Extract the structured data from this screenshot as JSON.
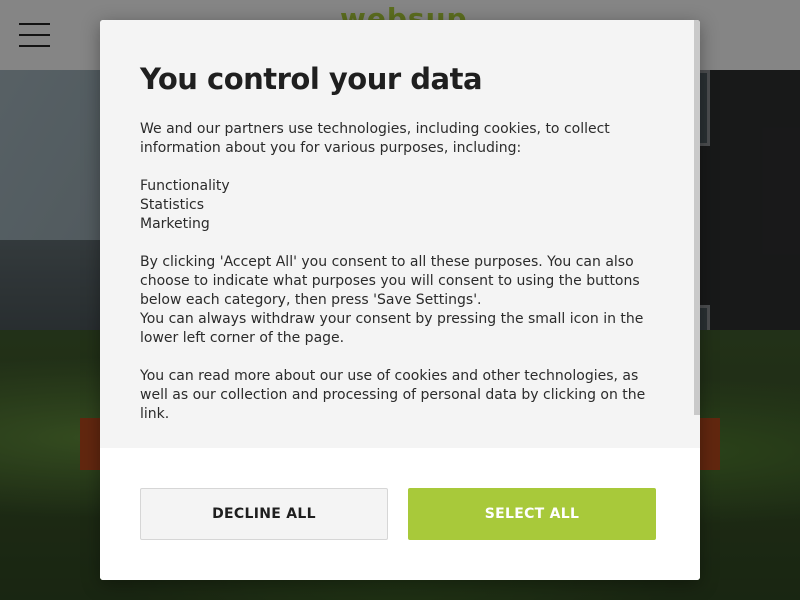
{
  "site": {
    "logo_text": "websup",
    "menu_icon": "hamburger-icon"
  },
  "consent": {
    "title": "You control your data",
    "intro": "We and our partners use technologies, including cookies, to collect information about you for various purposes, including:",
    "purposes": [
      "Functionality",
      "Statistics",
      "Marketing"
    ],
    "paragraph_accept": "By clicking 'Accept All' you consent to all these purposes. You can also choose to indicate what purposes you will consent to using the buttons below each category, then press 'Save Settings'.",
    "paragraph_withdraw": "You can always withdraw your consent by pressing the small icon in the lower left corner of the page.",
    "paragraph_more": "You can read more about our use of cookies and other technologies, as well as our collection and processing of personal data by clicking on the link.",
    "decline_label": "DECLINE ALL",
    "select_label": "SELECT ALL"
  },
  "colors": {
    "accent": "#a8c93a",
    "header_bg": "#f2f2f2",
    "modal_bg": "#f4f4f4",
    "hero_button": "#b2471c"
  }
}
